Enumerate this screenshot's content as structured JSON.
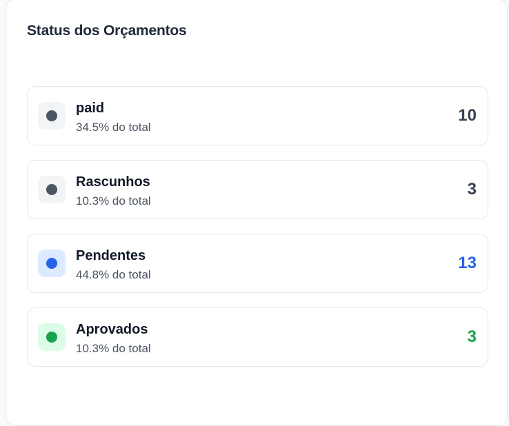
{
  "title": "Status dos Orçamentos",
  "items": [
    {
      "label": "paid",
      "subtitle": "34.5% do total",
      "count": "10",
      "color": "#4b5563",
      "bg": "#f3f4f6",
      "count_color": "#374151"
    },
    {
      "label": "Rascunhos",
      "subtitle": "10.3% do total",
      "count": "3",
      "color": "#4b5563",
      "bg": "#f3f4f6",
      "count_color": "#374151"
    },
    {
      "label": "Pendentes",
      "subtitle": "44.8% do total",
      "count": "13",
      "color": "#2563eb",
      "bg": "#dbeafe",
      "count_color": "#2563eb"
    },
    {
      "label": "Aprovados",
      "subtitle": "10.3% do total",
      "count": "3",
      "color": "#16a34a",
      "bg": "#dcfce7",
      "count_color": "#16a34a"
    }
  ]
}
